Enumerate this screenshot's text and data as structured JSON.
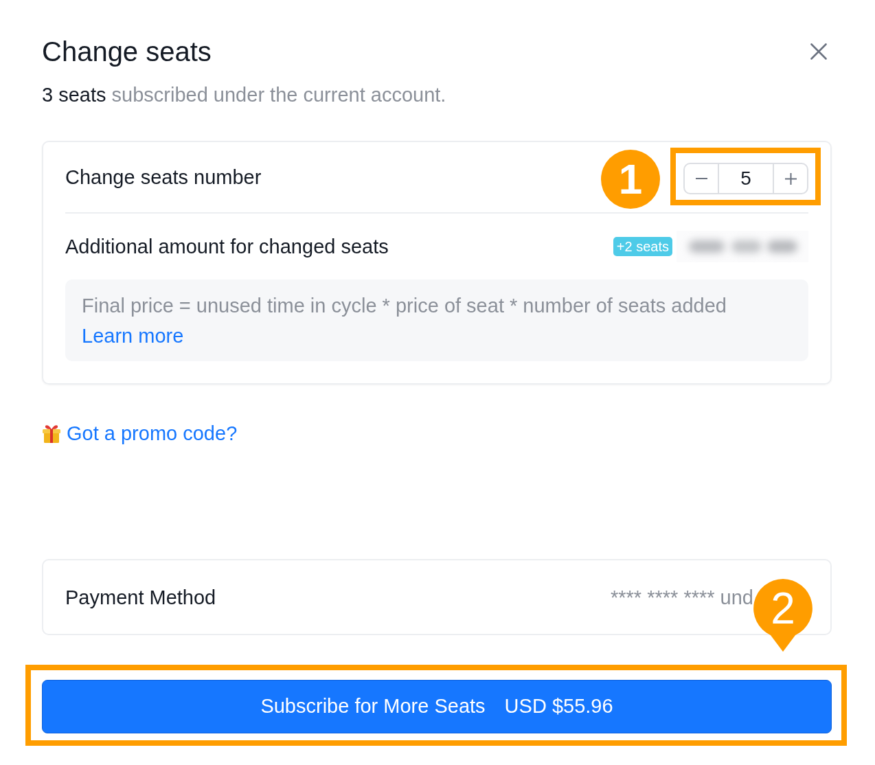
{
  "dialog": {
    "title": "Change seats",
    "subtitle": {
      "count": "3 seats",
      "text": "subscribed under the current account."
    }
  },
  "seats_card": {
    "stepper_row": {
      "label": "Change seats number",
      "stepper": {
        "value": "5",
        "highlighted": true,
        "callout": {
          "kind": "circle",
          "number": "1"
        }
      }
    },
    "amount_row": {
      "label": "Additional amount for changed seats",
      "badge": "+2 seats"
    },
    "note": {
      "text": "Final price = unused time in cycle * price of seat * number of seats added",
      "link": "Learn more"
    }
  },
  "promo": {
    "link": "Got a promo code?"
  },
  "payment_card": {
    "label": "Payment Method",
    "card_number": "**** **** **** und"
  },
  "submit_button": {
    "label": "Subscribe for More Seats",
    "price": "USD $55.96",
    "highlighted": true,
    "callout": {
      "kind": "pin",
      "number": "2"
    }
  }
}
